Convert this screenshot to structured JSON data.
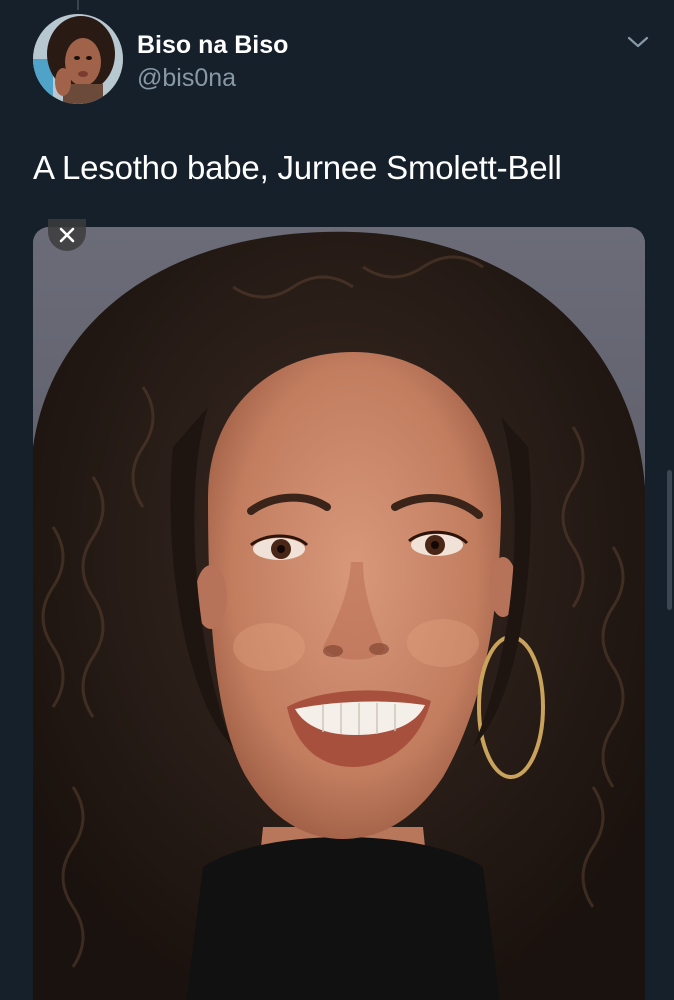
{
  "tweet": {
    "display_name": "Biso na Biso",
    "handle": "@bis0na",
    "text": "A Lesotho babe, Jurnee Smolett-Bell"
  },
  "icons": {
    "menu": "chevron-down-icon",
    "close": "close-icon"
  },
  "colors": {
    "background": "#15202b",
    "primary_text": "#ffffff",
    "secondary_text": "#8899a6",
    "divider": "#38444d"
  }
}
